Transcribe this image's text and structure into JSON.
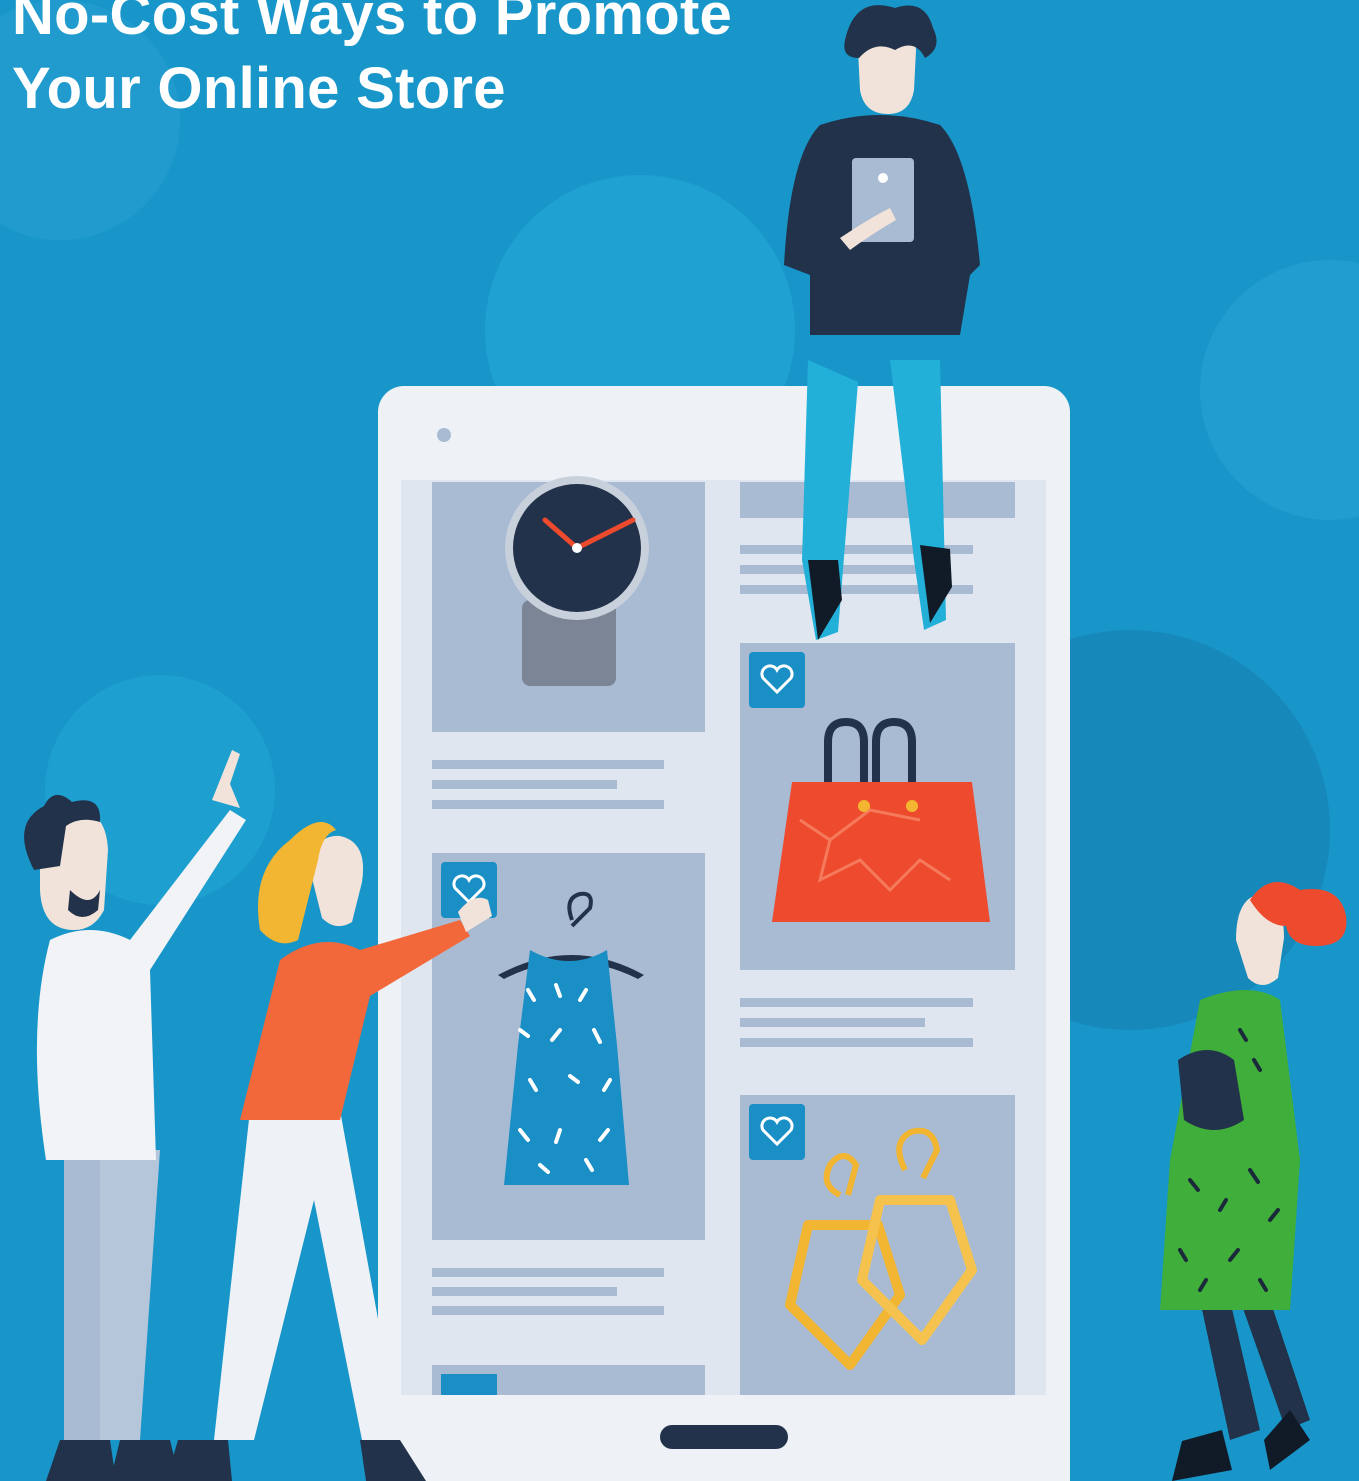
{
  "title": {
    "line1": "No-Cost Ways to Promote",
    "line2": "Your Online Store"
  },
  "colors": {
    "background": "#1896c9",
    "phone": "#eef2f6",
    "card": "#a9bbd3",
    "accent_blue": "#1a8fc6",
    "accent_red": "#ee4a2e",
    "accent_green": "#3fae3a",
    "gold": "#f2b632",
    "navy": "#22324a"
  },
  "icons": {
    "heart_count": 4,
    "items": [
      "watch",
      "bag",
      "dress",
      "earrings"
    ]
  }
}
